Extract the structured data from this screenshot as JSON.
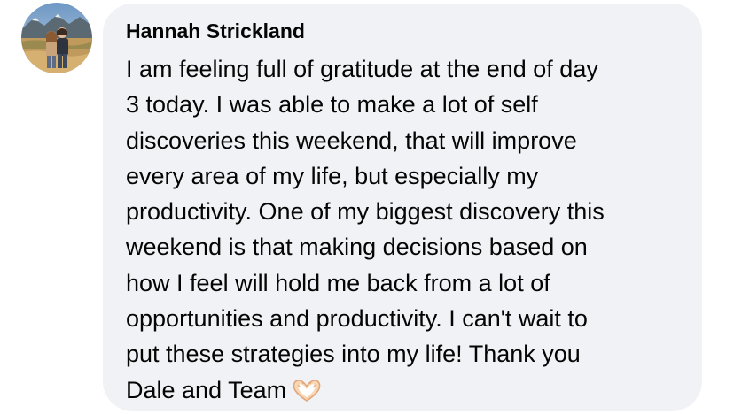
{
  "comment": {
    "author": "Hannah Strickland",
    "avatar_icon": "profile-photo",
    "text": "I am feeling full of gratitude at the end of day\n3 today. I was able to make a lot of self\ndiscoveries this weekend, that will improve\nevery area of my life, but especially my\nproductivity. One of my biggest discovery this\nweekend is that making decisions based on\nhow I feel will hold me back from a lot of\nopportunities and productivity. I can't wait to\nput these strategies into my life! Thank you\nDale and Team",
    "emoji": "🫶🏼",
    "emoji_icon": "heart-hands-icon"
  },
  "colors": {
    "bubble_background": "#f0f2f5",
    "text": "#050505",
    "page_background": "#ffffff"
  }
}
